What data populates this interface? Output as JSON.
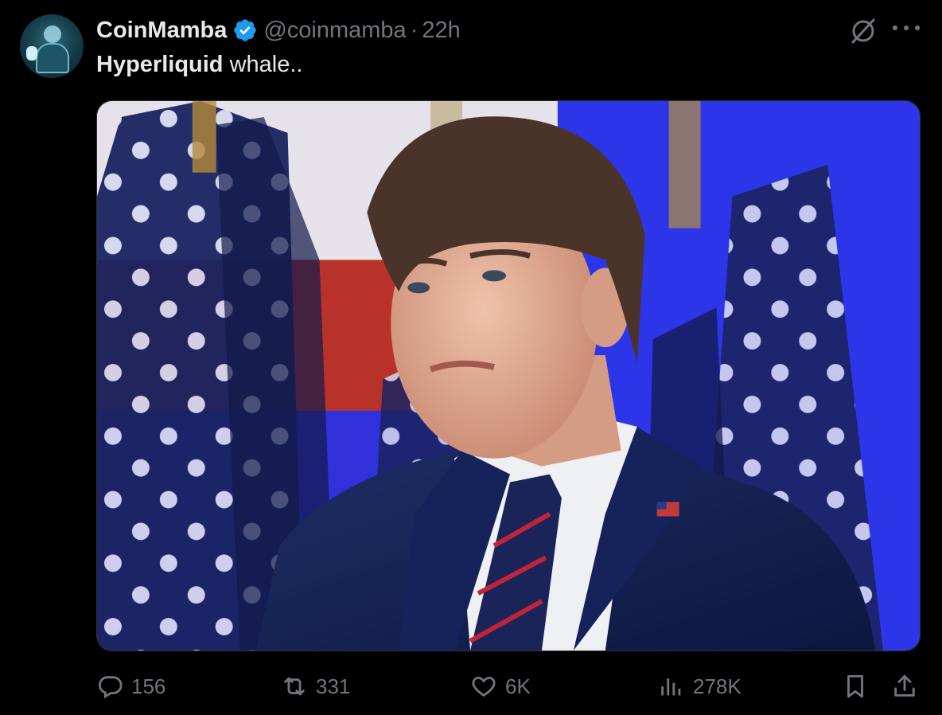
{
  "tweet": {
    "author": {
      "display_name": "CoinMamba",
      "handle": "@coinmamba",
      "verified": true
    },
    "separator": "·",
    "timestamp": "22h",
    "text_bold": "Hyperliquid",
    "text_rest": " whale..",
    "media": {
      "kind": "photo",
      "description_icon": "photo-icon"
    }
  },
  "actions": {
    "replies": "156",
    "reposts": "331",
    "likes": "6K",
    "views": "278K"
  },
  "icons": {
    "reply": "reply-icon",
    "repost": "repost-icon",
    "like": "heart-icon",
    "views": "views-chart-icon",
    "bookmark": "bookmark-icon",
    "share": "share-icon",
    "grok": "grok-icon",
    "more": "more-icon",
    "verified": "verified-badge-icon"
  },
  "colors": {
    "background": "#000000",
    "text_primary": "#e7e9ea",
    "text_secondary": "#71767b",
    "verified_blue": "#1d9bf0"
  }
}
